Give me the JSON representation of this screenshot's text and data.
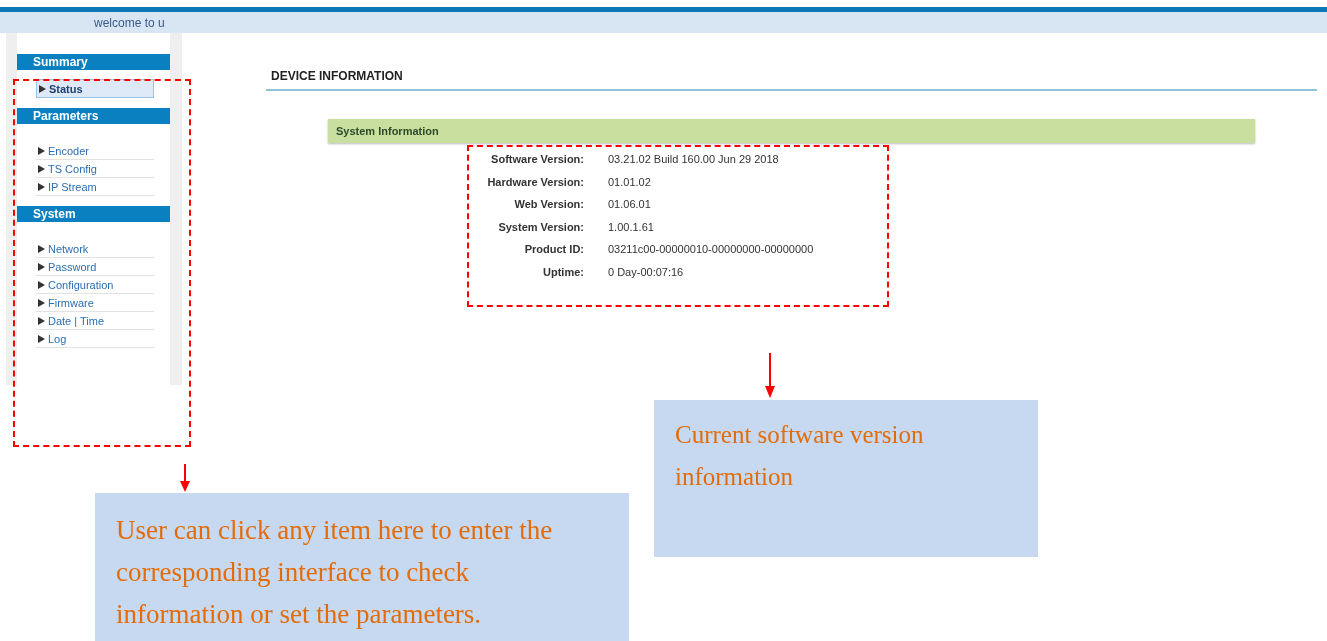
{
  "header": {
    "welcome": "welcome to u"
  },
  "sidebar": {
    "sections": [
      {
        "title": "Summary",
        "items": [
          {
            "label": "Status",
            "selected": true
          }
        ]
      },
      {
        "title": "Parameters",
        "items": [
          {
            "label": "Encoder",
            "selected": false
          },
          {
            "label": "TS Config",
            "selected": false
          },
          {
            "label": "IP Stream",
            "selected": false
          }
        ]
      },
      {
        "title": "System",
        "items": [
          {
            "label": "Network",
            "selected": false
          },
          {
            "label": "Password",
            "selected": false
          },
          {
            "label": "Configuration",
            "selected": false
          },
          {
            "label": "Firmware",
            "selected": false
          },
          {
            "label": "Date | Time",
            "selected": false
          },
          {
            "label": "Log",
            "selected": false
          }
        ]
      }
    ]
  },
  "page_title": "DEVICE INFORMATION",
  "panel": {
    "title": "System Information",
    "rows": [
      {
        "label": "Software Version:",
        "value": "03.21.02 Build 160.00 Jun 29 2018"
      },
      {
        "label": "Hardware Version:",
        "value": "01.01.02"
      },
      {
        "label": "Web Version:",
        "value": "01.06.01"
      },
      {
        "label": "System Version:",
        "value": "1.00.1.61"
      },
      {
        "label": "Product ID:",
        "value": "03211c00-00000010-00000000-00000000"
      },
      {
        "label": "Uptime:",
        "value": "0 Day-00:07:16"
      }
    ]
  },
  "annotations": [
    {
      "text": "User can click any item here to enter the corresponding interface to check information or set the parameters."
    },
    {
      "text": "Current software version information"
    }
  ]
}
